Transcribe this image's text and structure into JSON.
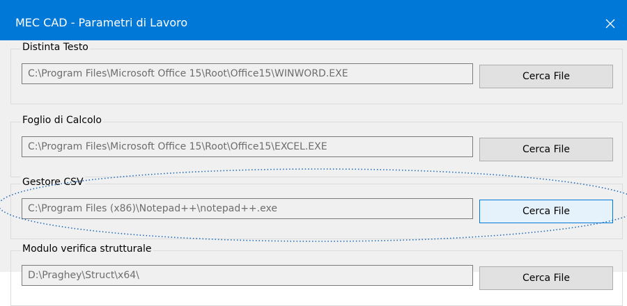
{
  "window": {
    "title": "MEC CAD - Parametri di Lavoro",
    "close_glyph": "✕"
  },
  "groups": [
    {
      "label": "Distinta Testo",
      "path": "C:\\Program Files\\Microsoft Office 15\\Root\\Office15\\WINWORD.EXE",
      "button": "Cerca File"
    },
    {
      "label": "Foglio di Calcolo",
      "path": "C:\\Program Files\\Microsoft Office 15\\Root\\Office15\\EXCEL.EXE",
      "button": "Cerca File"
    },
    {
      "label": "Gestore CSV",
      "path": "C:\\Program Files (x86)\\Notepad++\\notepad++.exe",
      "button": "Cerca File"
    },
    {
      "label": "Modulo verifica strutturale",
      "path": "D:\\Praghey\\Struct\\x64\\",
      "button": "Cerca File"
    }
  ],
  "colors": {
    "titlebar": "#0078d7",
    "client": "#f0f0f0",
    "button": "#e1e1e1",
    "button_hot": "#e5f1fb",
    "highlight": "#1e6bb8"
  }
}
